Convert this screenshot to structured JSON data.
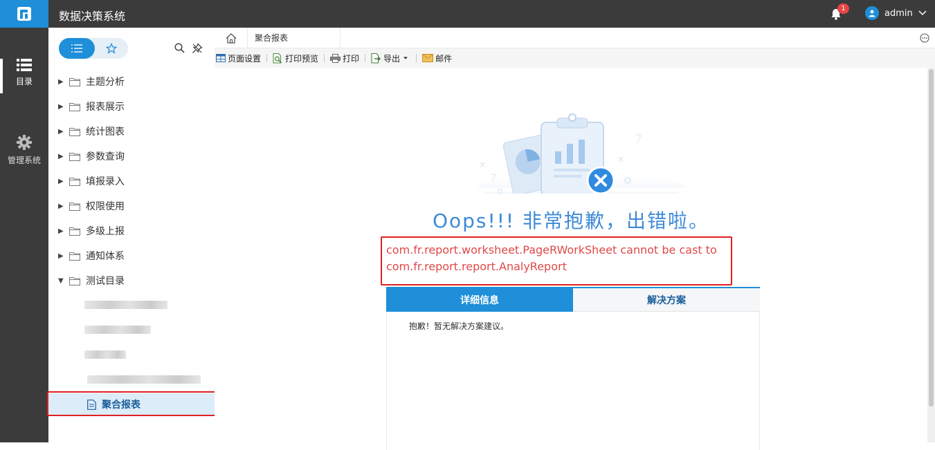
{
  "app": {
    "title": "数据决策系统"
  },
  "header": {
    "notification_count": "1",
    "user_name": "admin"
  },
  "rail": {
    "items": [
      {
        "label": "目录"
      },
      {
        "label": "管理系统"
      }
    ]
  },
  "sidebar": {
    "folders": [
      {
        "label": "主题分析"
      },
      {
        "label": "报表展示"
      },
      {
        "label": "统计图表"
      },
      {
        "label": "参数查询"
      },
      {
        "label": "填报录入"
      },
      {
        "label": "权限使用"
      },
      {
        "label": "多级上报"
      },
      {
        "label": "通知体系"
      },
      {
        "label": "测试目录"
      }
    ],
    "selected_report": "聚合报表"
  },
  "tabs": {
    "active_tab": "聚合报表"
  },
  "toolbar": {
    "page_setup": "页面设置",
    "print_preview": "打印预览",
    "print": "打印",
    "export": "导出",
    "mail": "邮件"
  },
  "error": {
    "headline": "Oops!!! 非常抱歉，出错啦。",
    "message_line1": "com.fr.report.worksheet.PageRWorkSheet cannot be cast to",
    "message_line2": "com.fr.report.report.AnalyReport"
  },
  "detail": {
    "tab_details": "详细信息",
    "tab_solution": "解决方案",
    "body_text": "抱歉！暂无解决方案建议。"
  },
  "colors": {
    "brand": "#1e8fd8",
    "header_bg": "#3b3b3b",
    "error": "#e04848",
    "outline": "#e02020"
  }
}
